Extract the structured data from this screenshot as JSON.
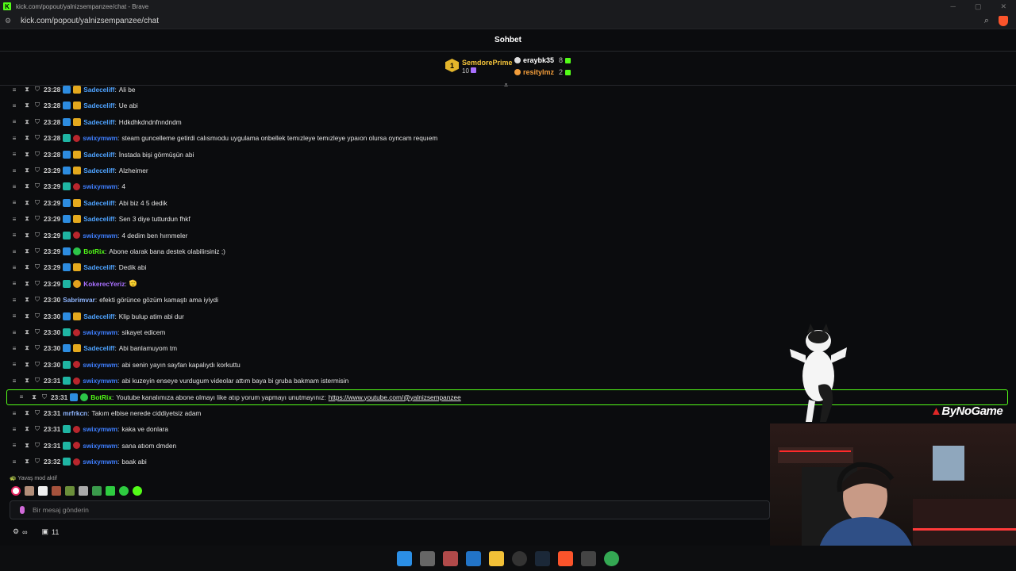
{
  "browser": {
    "title": "kick.com/popout/yalnizsempanzee/chat - Brave",
    "url": "kick.com/popout/yalnizsempanzee/chat"
  },
  "chat": {
    "header": "Sohbet",
    "leaderboard": {
      "first": {
        "rank": "1",
        "name": "SemdorePrime",
        "count": "10"
      },
      "others": [
        {
          "name": "eraybk35",
          "count": "8",
          "color": "#ffffff"
        },
        {
          "name": "resitylmz",
          "count": "2",
          "color": "#f29d3b"
        }
      ]
    },
    "messages": [
      {
        "time": "23:28",
        "badge": "crown",
        "user": "Sadeceliff",
        "color": "#4fa3ff",
        "text": "Ali be",
        "partial": true
      },
      {
        "time": "23:28",
        "badge": "crown",
        "user": "Sadeceliff",
        "color": "#4fa3ff",
        "text": "Ue abi"
      },
      {
        "time": "23:28",
        "badge": "crown",
        "user": "Sadeceliff",
        "color": "#4fa3ff",
        "text": "Hdkdhkdndnfnndndm"
      },
      {
        "time": "23:28",
        "badge": "red",
        "user": "swixymwm",
        "color": "#3f7fff",
        "text": "steam guncelleme getirdi calısmıodu uygulama onbellek temızleye temızleye ypaıon olursa oyncam requıem"
      },
      {
        "time": "23:28",
        "badge": "crown",
        "user": "Sadeceliff",
        "color": "#4fa3ff",
        "text": "İnstada bişi görmüşün abi"
      },
      {
        "time": "23:29",
        "badge": "crown",
        "user": "Sadeceliff",
        "color": "#4fa3ff",
        "text": "Alzheimer"
      },
      {
        "time": "23:29",
        "badge": "red",
        "user": "swixymwm",
        "color": "#3f7fff",
        "text": "4"
      },
      {
        "time": "23:29",
        "badge": "crown",
        "user": "Sadeceliff",
        "color": "#4fa3ff",
        "text": "Abi biz 4 5 dedik"
      },
      {
        "time": "23:29",
        "badge": "crown",
        "user": "Sadeceliff",
        "color": "#4fa3ff",
        "text": "Sen 3 diye tutturdun fhkf"
      },
      {
        "time": "23:29",
        "badge": "red",
        "user": "swixymwm",
        "color": "#3f7fff",
        "text": "4 dedim ben hırnmeler"
      },
      {
        "time": "23:29",
        "badge": "bot",
        "user": "BotRix",
        "color": "#53fc18",
        "text": "Abone olarak bana destek olabilirsiniz ;)"
      },
      {
        "time": "23:29",
        "badge": "crown",
        "user": "Sadeceliff",
        "color": "#4fa3ff",
        "text": "Dedik abi"
      },
      {
        "time": "23:29",
        "badge": "gold",
        "user": "KokerecYeriz",
        "color": "#a970ff",
        "text": "🫡"
      },
      {
        "time": "23:30",
        "badge": "none",
        "user": "Sabrimvar",
        "color": "#8fb6ff",
        "text": "efekti görünce gözüm kamaştı ama iyiydi"
      },
      {
        "time": "23:30",
        "badge": "crown",
        "user": "Sadeceliff",
        "color": "#4fa3ff",
        "text": "Klip bulup atim abi dur"
      },
      {
        "time": "23:30",
        "badge": "red",
        "user": "swixymwm",
        "color": "#3f7fff",
        "text": "sikayet edicem"
      },
      {
        "time": "23:30",
        "badge": "crown",
        "user": "Sadeceliff",
        "color": "#4fa3ff",
        "text": "Abi banlamuyom tm"
      },
      {
        "time": "23:30",
        "badge": "red",
        "user": "swixymwm",
        "color": "#3f7fff",
        "text": "abi senin yayın sayfan kapalıydı korkuttu"
      },
      {
        "time": "23:31",
        "badge": "red",
        "user": "swixymwm",
        "color": "#3f7fff",
        "text": "abi kuzeyin enseye vurdugum videolar attım baya bi gruba bakmam istermisin"
      },
      {
        "time": "23:31",
        "badge": "bot",
        "user": "BotRix",
        "color": "#53fc18",
        "text": "Youtube kanalımıza abone olmayı like atıp yorum yapmayı unutmayınız:",
        "link": "https://www.youtube.com/@yalnizsempanzee",
        "highlight": true
      },
      {
        "time": "23:31",
        "badge": "none",
        "user": "mrfrkcn",
        "color": "#8fb6ff",
        "text": "Takım elbise nerede ciddiyetsiz adam"
      },
      {
        "time": "23:31",
        "badge": "red",
        "user": "swixymwm",
        "color": "#3f7fff",
        "text": "kaka ve donlara"
      },
      {
        "time": "23:31",
        "badge": "red",
        "user": "swixymwm",
        "color": "#3f7fff",
        "text": "sana atıom dmden"
      },
      {
        "time": "23:32",
        "badge": "red",
        "user": "swixymwm",
        "color": "#3f7fff",
        "text": "baak abi"
      }
    ],
    "slow_mode": "Yavaş mod aktif",
    "input_placeholder": "Bir mesaj gönderin",
    "footer": {
      "infinity": "∞",
      "count": "11"
    }
  },
  "overlay": {
    "logo": "ByNoGame"
  }
}
